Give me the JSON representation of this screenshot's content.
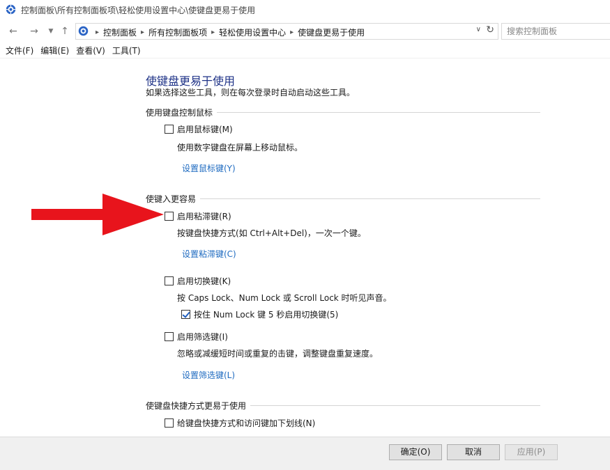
{
  "window": {
    "title": "控制面板\\所有控制面板项\\轻松使用设置中心\\使键盘更易于使用"
  },
  "nav": {
    "back_icon": "back-arrow-icon",
    "forward_icon": "forward-arrow-icon",
    "recent_icon": "chevron-down-icon",
    "up_icon": "up-arrow-icon",
    "breadcrumbs": [
      "控制面板",
      "所有控制面板项",
      "轻松使用设置中心",
      "使键盘更易于使用"
    ],
    "search_placeholder": "搜索控制面板"
  },
  "menu": [
    {
      "label": "文件(F)"
    },
    {
      "label": "编辑(E)"
    },
    {
      "label": "查看(V)"
    },
    {
      "label": "工具(T)"
    }
  ],
  "main": {
    "title": "使键盘更易于使用",
    "description": "如果选择这些工具，则在每次登录时自动启动这些工具。",
    "mouse_section": {
      "header": "使用键盘控制鼠标",
      "mouse_keys_label": "启用鼠标键(M)",
      "mouse_keys_checked": false,
      "mouse_keys_desc": "使用数字键盘在屏幕上移动鼠标。",
      "mouse_keys_link": "设置鼠标键(Y)"
    },
    "typing_section": {
      "header": "使键入更容易",
      "sticky_keys_label": "启用粘滞键(R)",
      "sticky_keys_checked": false,
      "sticky_keys_desc": "按键盘快捷方式(如 Ctrl+Alt+Del)，一次一个键。",
      "sticky_keys_link": "设置粘滞键(C)",
      "toggle_keys_label": "启用切换键(K)",
      "toggle_keys_checked": false,
      "toggle_keys_desc": "按 Caps Lock、Num Lock 或 Scroll Lock 时听见声音。",
      "toggle_hold_label": "按住 Num Lock 键 5 秒启用切换键(5)",
      "toggle_hold_checked": true,
      "filter_keys_label": "启用筛选键(I)",
      "filter_keys_checked": false,
      "filter_keys_desc": "忽略或减缓短时间或重复的击键，调整键盘重复速度。",
      "filter_keys_link": "设置筛选键(L)"
    },
    "shortcut_section": {
      "header": "使键盘快捷方式更易于使用",
      "underline_label": "给键盘快捷方式和访问键加下划线(N)",
      "underline_checked": false
    }
  },
  "annotation": {
    "arrow_color": "#e8141c"
  },
  "footer": {
    "ok_label": "确定(O)",
    "cancel_label": "取消",
    "apply_label": "应用(P)"
  }
}
